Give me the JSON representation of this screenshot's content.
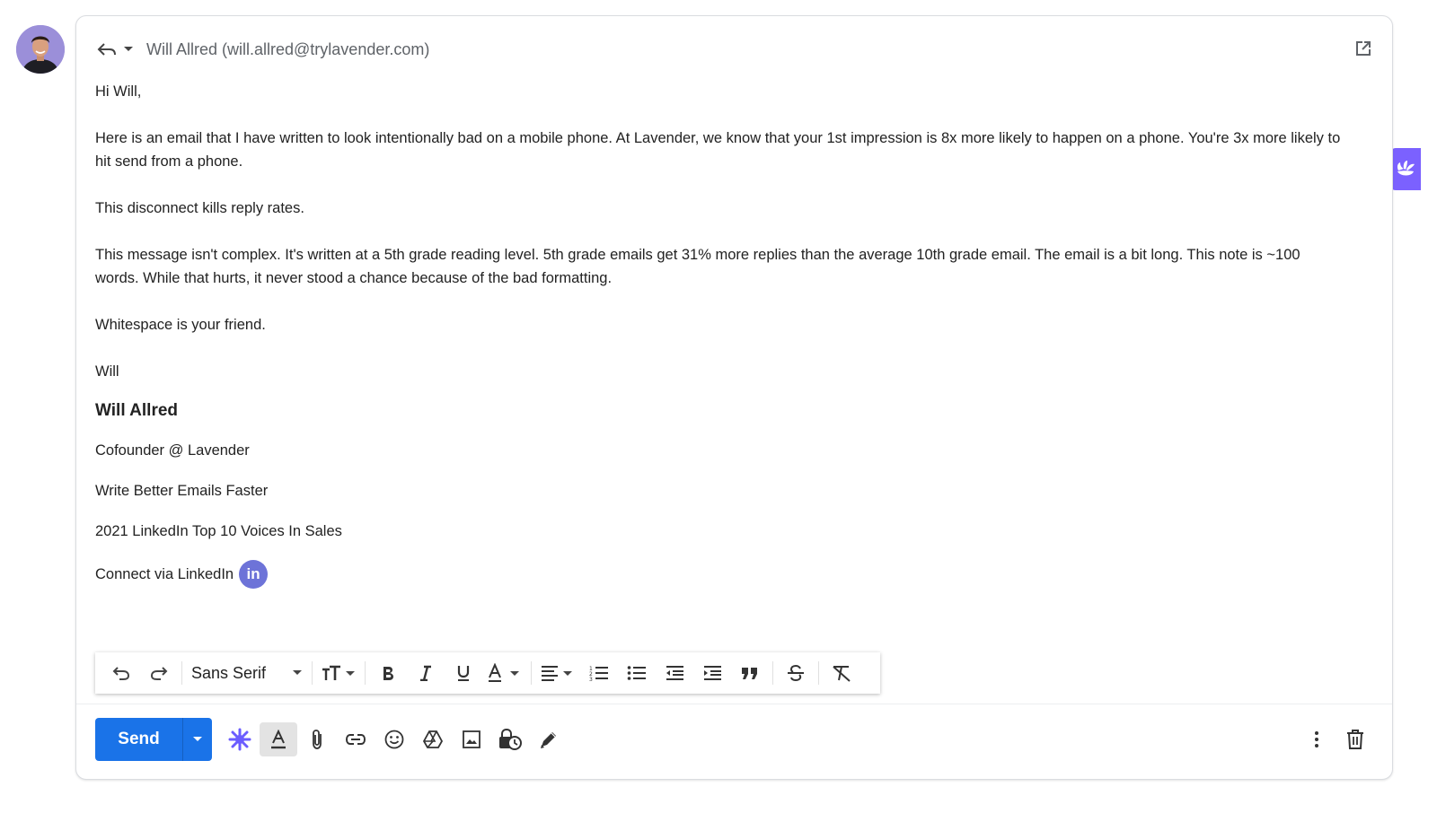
{
  "header": {
    "recipient": "Will Allred (will.allred@trylavender.com)"
  },
  "message": {
    "greeting": "Hi Will,",
    "paragraphs": [
      "Here is an email that I have written to look intentionally bad on a mobile phone. At Lavender, we know that your 1st impression is 8x more likely to happen on a phone. You're 3x more likely to hit send from a phone.",
      "This disconnect kills reply rates.",
      "This message isn't complex. It's written at a 5th grade reading level. 5th grade emails get 31% more replies than the average 10th grade email. The email is a bit long. This note is ~100 words. While that hurts, it never stood a chance because of the bad formatting.",
      "Whitespace is your friend."
    ],
    "signoff": "Will"
  },
  "signature": {
    "name": "Will Allred",
    "title": "Cofounder @ Lavender",
    "tagline": "Write Better Emails Faster",
    "award": "2021 LinkedIn Top 10 Voices In Sales",
    "connect_label": "Connect via LinkedIn",
    "linkedin_badge": "in"
  },
  "toolbar": {
    "font_family": "Sans Serif"
  },
  "compose": {
    "send_label": "Send"
  },
  "colors": {
    "send_blue": "#1a73e8",
    "lavender_purple": "#7b61ff",
    "linkedin_badge": "#6d73d8"
  }
}
